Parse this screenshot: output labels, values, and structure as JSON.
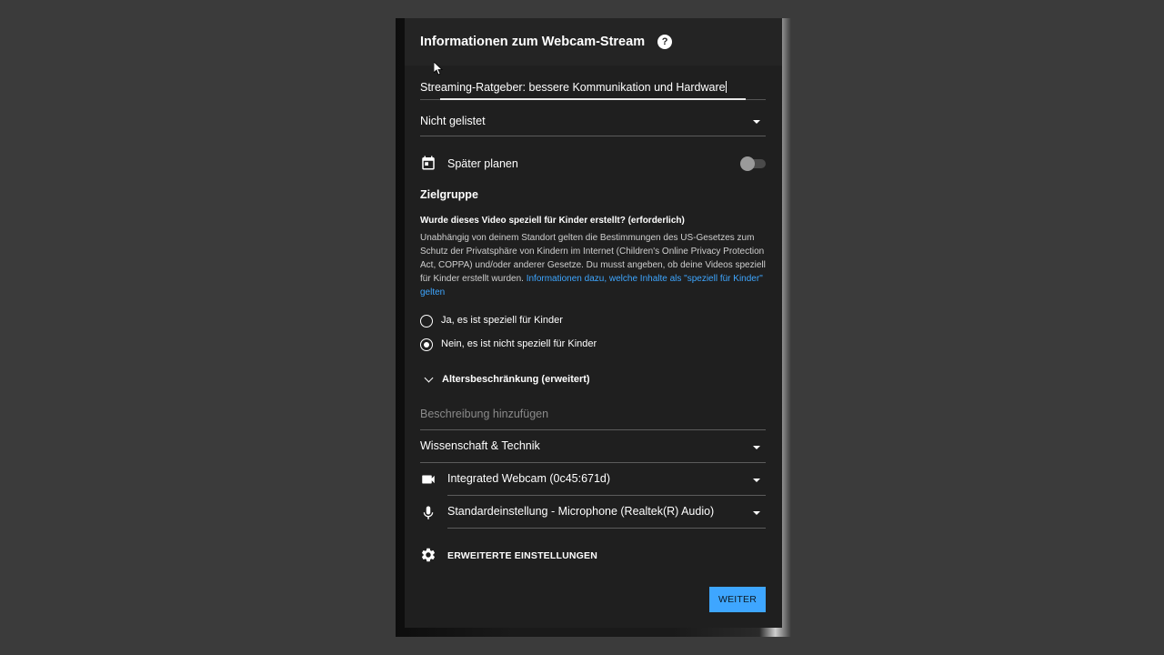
{
  "dialog": {
    "title": "Informationen zum Webcam-Stream",
    "help_icon": "help-circle-icon"
  },
  "form": {
    "stream_title_value": "Streaming-Ratgeber: bessere Kommunikation und Hardware",
    "visibility_value": "Nicht gelistet",
    "schedule_label": "Später planen",
    "schedule_enabled": false,
    "audience": {
      "section_title": "Zielgruppe",
      "question": "Wurde dieses Video speziell für Kinder erstellt? (erforderlich)",
      "paragraph": "Unabhängig von deinem Standort gelten die Bestimmungen des US-Gesetzes zum Schutz der Privatsphäre von Kindern im Internet (Children's Online Privacy Protection Act, COPPA) und/oder anderer Gesetze. Du musst angeben, ob deine Videos speziell für Kinder erstellt wurden. ",
      "link_text": "Informationen dazu, welche Inhalte als \"speziell für Kinder\" gelten",
      "option_yes": "Ja, es ist speziell für Kinder",
      "option_no": "Nein, es ist nicht speziell für Kinder",
      "selected": "no"
    },
    "age_restriction_label": "Altersbeschränkung (erweitert)",
    "description_placeholder": "Beschreibung hinzufügen",
    "category_value": "Wissenschaft & Technik",
    "camera_value": "Integrated Webcam (0c45:671d)",
    "microphone_value": "Standardeinstellung - Microphone (Realtek(R) Audio)",
    "advanced_settings_label": "ERWEITERTE EINSTELLUNGEN",
    "next_button_label": "WEITER"
  },
  "colors": {
    "accent": "#3ea6ff",
    "dialog_bg": "#1f1f1f",
    "page_bg": "#3b3b3b"
  }
}
